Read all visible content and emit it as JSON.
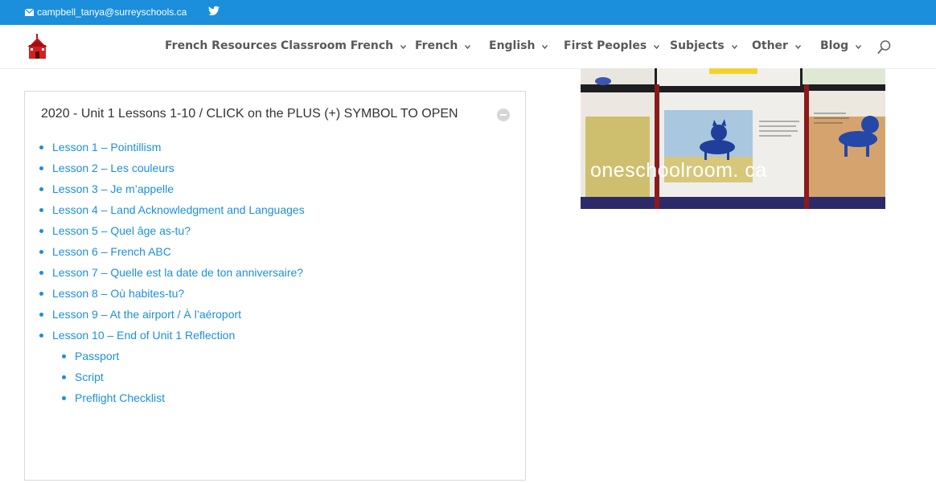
{
  "topbar": {
    "email": "campbell_tanya@surreyschools.ca",
    "icons": [
      "envelope-icon",
      "twitter-icon"
    ],
    "background": "#1b8fdb"
  },
  "header": {
    "logo": "schoolhouse-logo",
    "nav": [
      {
        "label": "French Resources",
        "has_dropdown": false
      },
      {
        "label": "Classroom French",
        "has_dropdown": true
      },
      {
        "label": "French",
        "has_dropdown": true
      },
      {
        "label": "English",
        "has_dropdown": true
      },
      {
        "label": "First Peoples",
        "has_dropdown": true
      },
      {
        "label": "Subjects",
        "has_dropdown": true
      },
      {
        "label": "Other",
        "has_dropdown": true
      },
      {
        "label": "Blog",
        "has_dropdown": true
      }
    ],
    "search_icon": "search-icon"
  },
  "accordion": {
    "title": "2020 - Unit 1 Lessons 1-10 / CLICK on the PLUS (+) SYMBOL TO OPEN",
    "toggle_icon": "minus-circle-icon",
    "lessons": [
      "Lesson 1 – Pointillism",
      "Lesson 2 – Les couleurs",
      "Lesson 3 – Je m’appelle",
      "Lesson 4 – Land Acknowledgment and Languages",
      "Lesson 5 – Quel âge as-tu?",
      "Lesson 6 – French ABC",
      "Lesson 7 – Quelle est la date de ton anniversaire?",
      "Lesson 8 – Où habites-tu?",
      "Lesson 9 – At the airport / À l’aéroport",
      "Lesson 10 – End of Unit 1 Reflection"
    ],
    "sub_items": [
      "Passport",
      "Script",
      "Preflight Checklist"
    ],
    "link_color": "#1b8fdb"
  },
  "sidebar_image": {
    "watermark": "oneschoolroom. ca"
  }
}
